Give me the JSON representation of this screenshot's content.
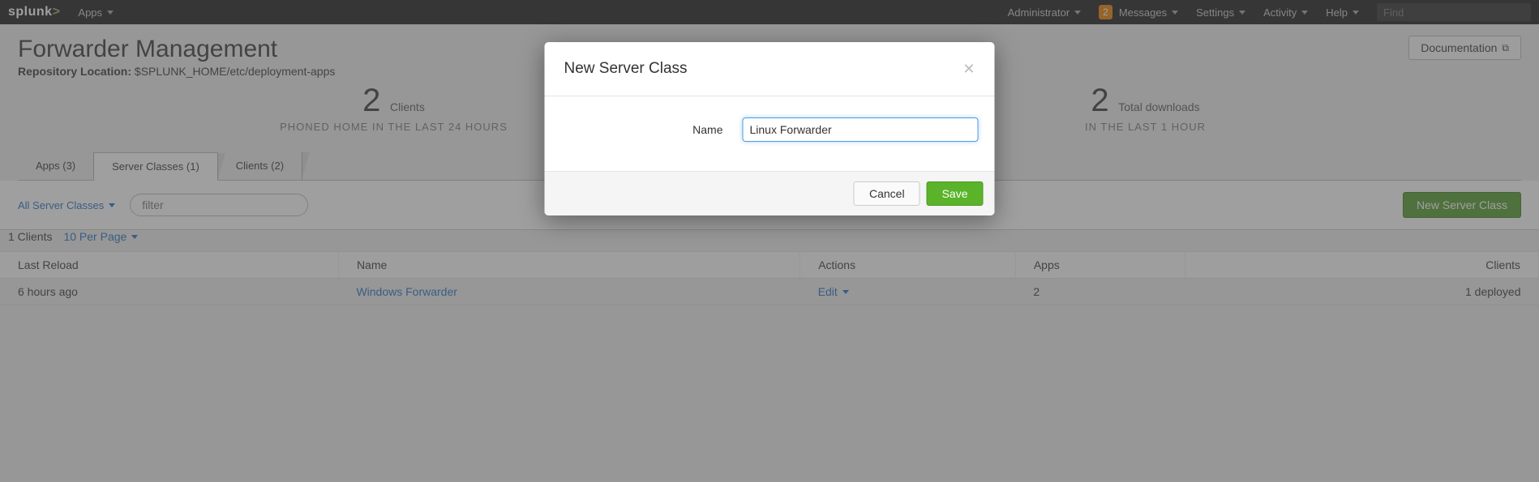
{
  "topbar": {
    "logo": "splunk",
    "apps_label": "Apps",
    "admin_label": "Administrator",
    "messages_badge": "2",
    "messages_label": "Messages",
    "settings_label": "Settings",
    "activity_label": "Activity",
    "help_label": "Help",
    "find_placeholder": "Find"
  },
  "page": {
    "title": "Forwarder Management",
    "repo_label": "Repository Location:",
    "repo_value": "$SPLUNK_HOME/etc/deployment-apps",
    "doc_button": "Documentation"
  },
  "stats": {
    "clients_num": "2",
    "clients_label": "Clients",
    "clients_sub": "PHONED HOME IN THE LAST 24 HOURS",
    "downloads_num": "2",
    "downloads_label": "Total downloads",
    "downloads_sub": "IN THE LAST 1 HOUR"
  },
  "tabs": {
    "apps": "Apps (3)",
    "server_classes": "Server Classes (1)",
    "clients": "Clients (2)"
  },
  "filter": {
    "all_classes": "All Server Classes",
    "filter_placeholder": "filter",
    "new_button": "New Server Class"
  },
  "table_meta": {
    "count": "1 Clients",
    "per_page": "10 Per Page"
  },
  "table": {
    "headers": {
      "last_reload": "Last Reload",
      "name": "Name",
      "actions": "Actions",
      "apps": "Apps",
      "clients": "Clients"
    },
    "row": {
      "last_reload": "6 hours ago",
      "name": "Windows Forwarder",
      "actions": "Edit",
      "apps": "2",
      "clients": "1 deployed"
    }
  },
  "modal": {
    "title": "New Server Class",
    "field_label": "Name",
    "field_value": "Linux Forwarder",
    "cancel": "Cancel",
    "save": "Save"
  }
}
